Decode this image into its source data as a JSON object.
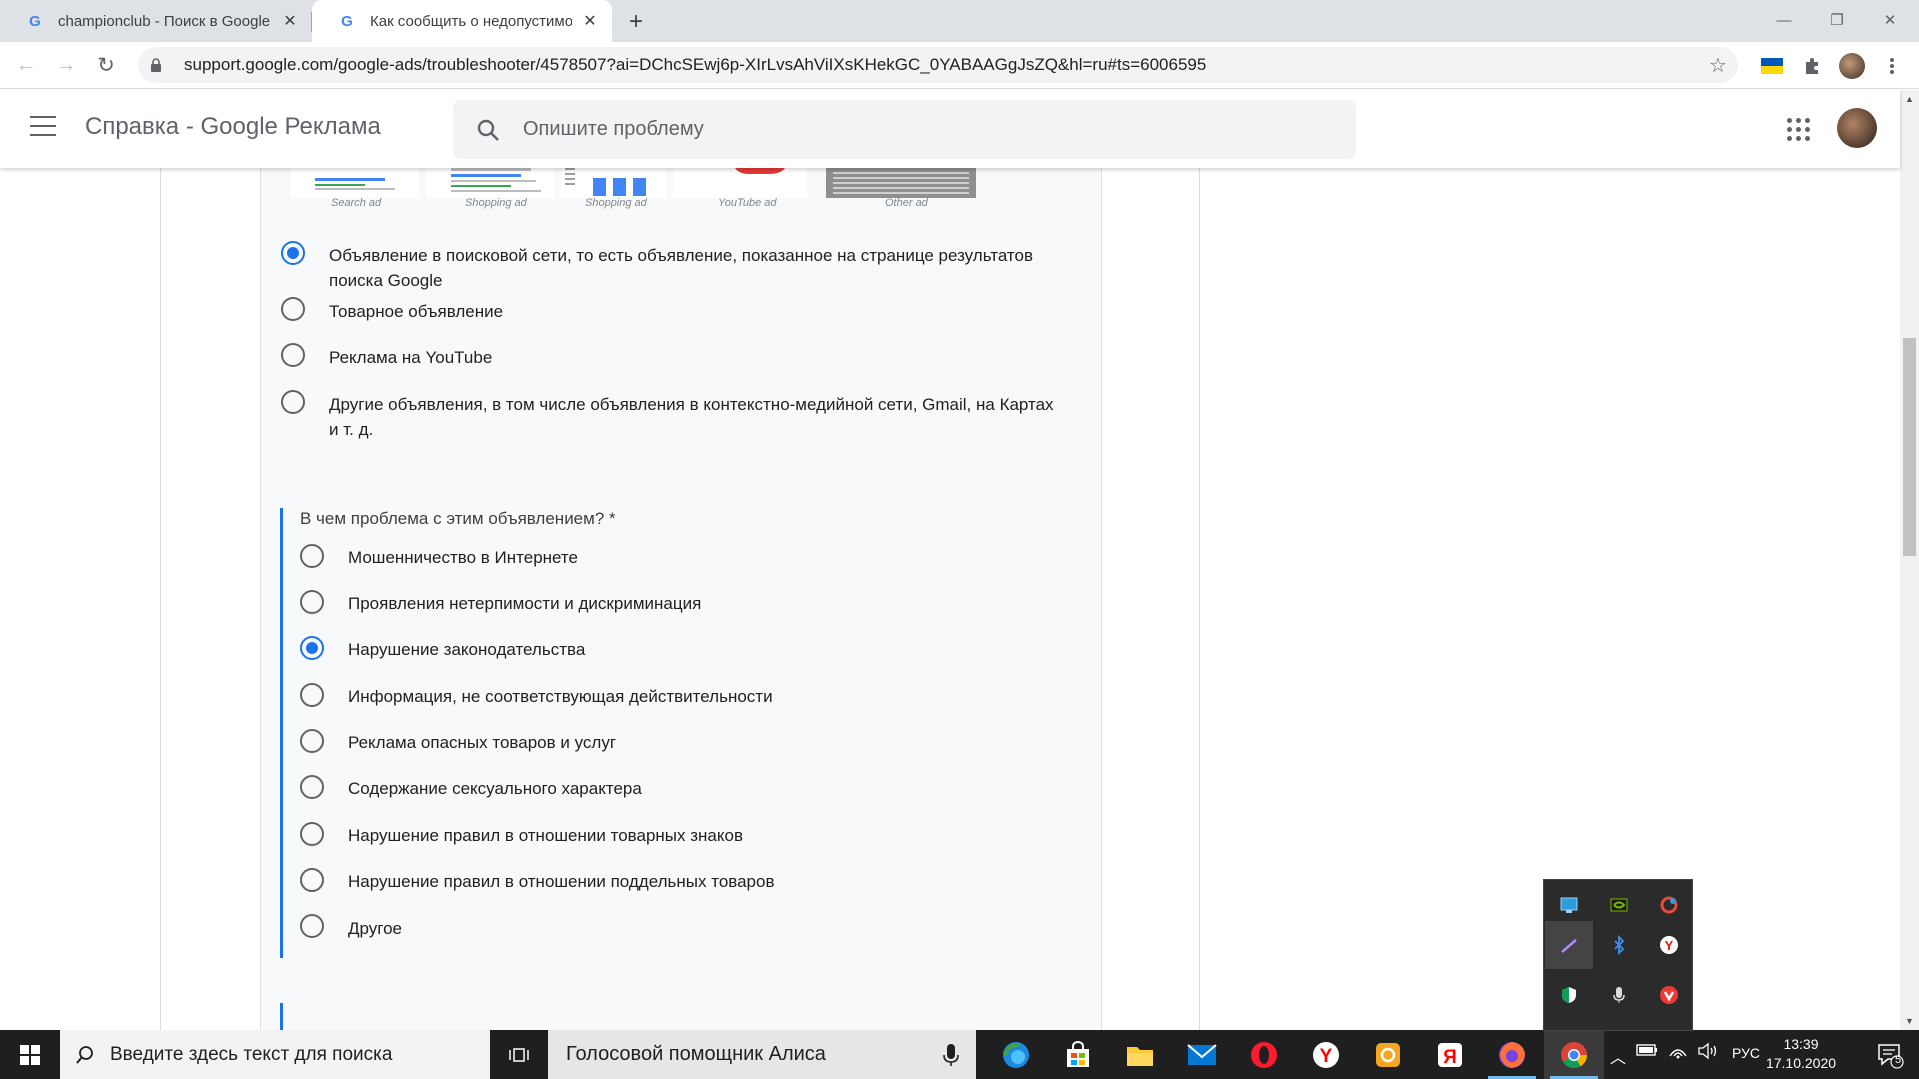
{
  "browser": {
    "tabs": [
      {
        "title": "championclub - Поиск в Google",
        "active": false
      },
      {
        "title": "Как сообщить о недопустимом",
        "active": true
      }
    ],
    "url": "support.google.com/google-ads/troubleshooter/4578507?ai=DChcSEwj6p-XIrLvsAhViIXsKHekGC_0YABAAGgJsZQ&hl=ru#ts=6006595"
  },
  "header": {
    "title": "Справка - Google Реклама",
    "search_placeholder": "Опишите проблему"
  },
  "ad_types": [
    "Search ad",
    "Shopping ad",
    "Shopping ad",
    "YouTube ad",
    "Other ad"
  ],
  "question1": {
    "options": [
      {
        "label_line1": "Объявление в поисковой сети, то есть объявление, показанное на странице результатов",
        "label_line2": "поиска Google",
        "checked": true
      },
      {
        "label_line1": "Товарное объявление",
        "label_line2": "",
        "checked": false
      },
      {
        "label_line1": "Реклама на YouTube",
        "label_line2": "",
        "checked": false
      },
      {
        "label_line1": "Другие объявления, в том числе объявления в контекстно-медийной сети, Gmail, на Картах",
        "label_line2": "и т. д.",
        "checked": false
      }
    ]
  },
  "question2": {
    "label": "В чем проблема с этим объявлением? *",
    "options": [
      {
        "label": "Мошенничество в Интернете",
        "checked": false
      },
      {
        "label": "Проявления нетерпимости и дискриминация",
        "checked": false
      },
      {
        "label": "Нарушение законодательства",
        "checked": true
      },
      {
        "label": "Информация, не соответствующая действительности",
        "checked": false
      },
      {
        "label": "Реклама опасных товаров и услуг",
        "checked": false
      },
      {
        "label": "Содержание сексуального характера",
        "checked": false
      },
      {
        "label": "Нарушение правил в отношении товарных знаков",
        "checked": false
      },
      {
        "label": "Нарушение правил в отношении поддельных товаров",
        "checked": false
      },
      {
        "label": "Другое",
        "checked": false
      }
    ]
  },
  "taskbar": {
    "search_placeholder": "Введите здесь текст для поиска",
    "alice_label": "Голосовой помощник Алиса",
    "language": "РУС",
    "time": "13:39",
    "date": "17.10.2020",
    "notifications": "5"
  },
  "colors": {
    "accent": "#1a73e8",
    "form_bg": "#f8f9fa",
    "taskbar": "#1f1f1f"
  }
}
